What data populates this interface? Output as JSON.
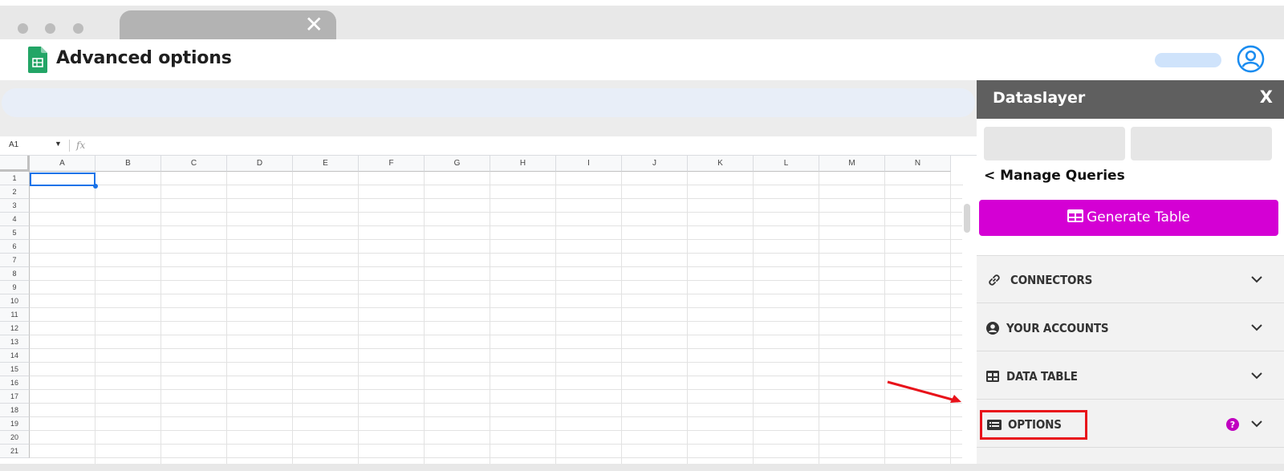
{
  "browser": {
    "tab_close_glyph": "✕"
  },
  "app": {
    "title": "Advanced options",
    "logo_icon": "google-sheets-icon",
    "avatar_icon": "user-circle-icon"
  },
  "sheet": {
    "name_box": "A1",
    "formula_label": "fx",
    "columns": [
      "A",
      "B",
      "C",
      "D",
      "E",
      "F",
      "G",
      "H",
      "I",
      "J",
      "K",
      "L",
      "M",
      "N"
    ],
    "rows": [
      "1",
      "2",
      "3",
      "4",
      "5",
      "6",
      "7",
      "8",
      "9",
      "10",
      "11",
      "12",
      "13",
      "14",
      "15",
      "16",
      "17",
      "18",
      "19",
      "20",
      "21"
    ],
    "selected_cell": "A1"
  },
  "panel": {
    "title": "Dataslayer",
    "close_label": "X",
    "manage_queries": "< Manage Queries",
    "generate_button": "Generate Table",
    "accordion": [
      {
        "label": "CONNECTORS",
        "icon": "link-icon"
      },
      {
        "label": "YOUR ACCOUNTS",
        "icon": "account-icon"
      },
      {
        "label": "DATA TABLE",
        "icon": "table-icon"
      },
      {
        "label": "OPTIONS",
        "icon": "list-icon",
        "help": true
      }
    ]
  },
  "colors": {
    "generate_button": "#d400d4",
    "panel_header": "#5f5f5f",
    "highlight": "#e8121a",
    "selection": "#1a73e8",
    "help_badge": "#c000c0"
  }
}
